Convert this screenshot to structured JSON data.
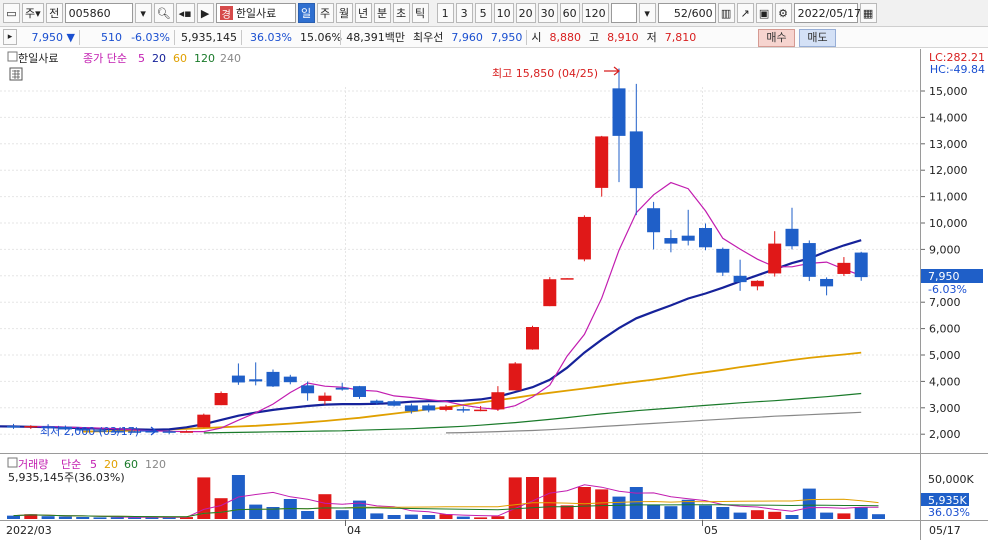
{
  "toolbar": {
    "market": "주",
    "kind": "전",
    "code": "005860",
    "name_badge": "경",
    "name": "한일사료",
    "periods": [
      "일",
      "주",
      "월",
      "년",
      "분",
      "초",
      "틱"
    ],
    "selected_period": "일",
    "intervals": [
      "1",
      "3",
      "5",
      "10",
      "20",
      "30",
      "60",
      "120"
    ],
    "count": "52",
    "count_total": "/600",
    "date": "2022/05/17"
  },
  "quote": {
    "price": "7,950 ▼",
    "change": "510",
    "change_pct": "-6.03%",
    "volume": "5,935,145",
    "vol_ratio": "36.03%",
    "turnover": "15.06%",
    "amount": "48,391백만",
    "best_ask_label": "최우선",
    "best_ask": "7,960",
    "best_bid": "7,950",
    "open_label": "시",
    "open": "8,880",
    "high_label": "고",
    "high": "8,910",
    "low_label": "저",
    "low": "7,810",
    "buy": "매수",
    "sell": "매도"
  },
  "price_panel": {
    "title": "한일사료",
    "ma_legend": "종가 단순",
    "ma_periods": [
      {
        "label": "5",
        "color": "#c21db0"
      },
      {
        "label": "20",
        "color": "#16229a"
      },
      {
        "label": "60",
        "color": "#e0a000"
      },
      {
        "label": "120",
        "color": "#1a7a2a"
      },
      {
        "label": "240",
        "color": "#888888"
      }
    ],
    "lc": "LC:282.21",
    "hc": "HC:-49.84",
    "high_note": "최고 15,850 (04/25)",
    "low_note": "최저 2,000 (03/17)",
    "last_price": "7,950",
    "last_pct": "-6.03%",
    "y_ticks": [
      "15,000",
      "14,000",
      "13,000",
      "12,000",
      "11,000",
      "10,000",
      "9,000",
      "8,000",
      "7,000",
      "6,000",
      "5,000",
      "4,000",
      "3,000",
      "2,000"
    ]
  },
  "volume_panel": {
    "title": "거래량",
    "ma_legend": "단순",
    "ma_periods": [
      {
        "label": "5",
        "color": "#c21db0"
      },
      {
        "label": "20",
        "color": "#e0a000"
      },
      {
        "label": "60",
        "color": "#1a7a2a"
      },
      {
        "label": "120",
        "color": "#888888"
      }
    ],
    "info": "5,935,145주(36.03%)",
    "y_tick": "50,000K",
    "last_volume": "5,935K",
    "last_pct": "36.03%"
  },
  "x_axis": {
    "labels": [
      "2022/03",
      "04",
      "05",
      "05/17"
    ]
  },
  "colors": {
    "up": "#e01818",
    "down": "#1f5fc8",
    "ma5": "#c21db0",
    "ma20": "#16229a",
    "ma60": "#e0a000",
    "ma120": "#1a7a2a",
    "ma240": "#888888"
  },
  "chart_data": {
    "type": "candlestick",
    "price_unit": "KRW",
    "candles": [
      {
        "o": 2310,
        "h": 2390,
        "l": 2200,
        "c": 2250
      },
      {
        "o": 2280,
        "h": 2340,
        "l": 2200,
        "c": 2310
      },
      {
        "o": 2300,
        "h": 2380,
        "l": 2200,
        "c": 2230
      },
      {
        "o": 2280,
        "h": 2330,
        "l": 2150,
        "c": 2180
      },
      {
        "o": 2200,
        "h": 2260,
        "l": 2100,
        "c": 2140
      },
      {
        "o": 2150,
        "h": 2220,
        "l": 2050,
        "c": 2100
      },
      {
        "o": 2120,
        "h": 2160,
        "l": 2060,
        "c": 2110
      },
      {
        "o": 2110,
        "h": 2130,
        "l": 2080,
        "c": 2100
      },
      {
        "o": 2120,
        "h": 2140,
        "l": 2090,
        "c": 2110
      },
      {
        "o": 2110,
        "h": 2140,
        "l": 2000,
        "c": 2090
      },
      {
        "o": 2100,
        "h": 2140,
        "l": 2080,
        "c": 2110
      },
      {
        "o": 2260,
        "h": 2780,
        "l": 2260,
        "c": 2740
      },
      {
        "o": 3100,
        "h": 3620,
        "l": 3100,
        "c": 3560
      },
      {
        "o": 4220,
        "h": 4680,
        "l": 3870,
        "c": 3960
      },
      {
        "o": 4080,
        "h": 4720,
        "l": 3850,
        "c": 4000
      },
      {
        "o": 4360,
        "h": 4450,
        "l": 3790,
        "c": 3810
      },
      {
        "o": 4180,
        "h": 4250,
        "l": 3890,
        "c": 3970
      },
      {
        "o": 3850,
        "h": 4000,
        "l": 3270,
        "c": 3550
      },
      {
        "o": 3260,
        "h": 3580,
        "l": 3120,
        "c": 3460
      },
      {
        "o": 3760,
        "h": 3950,
        "l": 3650,
        "c": 3690
      },
      {
        "o": 3820,
        "h": 3830,
        "l": 3340,
        "c": 3410
      },
      {
        "o": 3270,
        "h": 3310,
        "l": 3110,
        "c": 3180
      },
      {
        "o": 3250,
        "h": 3300,
        "l": 3050,
        "c": 3080
      },
      {
        "o": 3090,
        "h": 3160,
        "l": 2780,
        "c": 2870
      },
      {
        "o": 3090,
        "h": 3150,
        "l": 2830,
        "c": 2900
      },
      {
        "o": 2920,
        "h": 3110,
        "l": 2870,
        "c": 3050
      },
      {
        "o": 2950,
        "h": 3050,
        "l": 2820,
        "c": 2900
      },
      {
        "o": 2910,
        "h": 3070,
        "l": 2870,
        "c": 2930
      },
      {
        "o": 2940,
        "h": 3820,
        "l": 2880,
        "c": 3590
      },
      {
        "o": 3660,
        "h": 4730,
        "l": 3660,
        "c": 4680
      },
      {
        "o": 5210,
        "h": 6110,
        "l": 5200,
        "c": 6060
      },
      {
        "o": 6850,
        "h": 7950,
        "l": 6850,
        "c": 7870
      },
      {
        "o": 7900,
        "h": 7910,
        "l": 7890,
        "c": 7910
      },
      {
        "o": 8620,
        "h": 10290,
        "l": 8550,
        "c": 10230
      },
      {
        "o": 11330,
        "h": 13300,
        "l": 11000,
        "c": 13280
      },
      {
        "o": 15100,
        "h": 15850,
        "l": 11550,
        "c": 13300
      },
      {
        "o": 13470,
        "h": 15270,
        "l": 10300,
        "c": 11320
      },
      {
        "o": 10560,
        "h": 10800,
        "l": 9000,
        "c": 9650
      },
      {
        "o": 9430,
        "h": 9740,
        "l": 8890,
        "c": 9220
      },
      {
        "o": 9520,
        "h": 10500,
        "l": 9150,
        "c": 9330
      },
      {
        "o": 9810,
        "h": 9980,
        "l": 8970,
        "c": 9080
      },
      {
        "o": 9020,
        "h": 9070,
        "l": 7990,
        "c": 8120
      },
      {
        "o": 8000,
        "h": 8610,
        "l": 7430,
        "c": 7760
      },
      {
        "o": 7600,
        "h": 7830,
        "l": 7450,
        "c": 7810
      },
      {
        "o": 8090,
        "h": 9690,
        "l": 7970,
        "c": 9220
      },
      {
        "o": 9780,
        "h": 10580,
        "l": 9000,
        "c": 9120
      },
      {
        "o": 9240,
        "h": 9340,
        "l": 7800,
        "c": 7960
      },
      {
        "o": 7880,
        "h": 7940,
        "l": 7260,
        "c": 7600
      },
      {
        "o": 8070,
        "h": 8710,
        "l": 7990,
        "c": 8490
      },
      {
        "o": 8880,
        "h": 8910,
        "l": 7810,
        "c": 7950
      }
    ],
    "volume_k": [
      4200,
      6000,
      3500,
      3000,
      2500,
      2000,
      2200,
      1800,
      1900,
      2100,
      2400,
      52000,
      26000,
      55000,
      18000,
      15000,
      25000,
      10000,
      31000,
      11000,
      23000,
      7000,
      5000,
      5500,
      5000,
      6000,
      3000,
      2000,
      3500,
      52000,
      52500,
      52000,
      17000,
      40000,
      37000,
      28000,
      40000,
      18000,
      16000,
      24000,
      17000,
      15000,
      8000,
      11000,
      9000,
      5000,
      38000,
      8000,
      7000,
      15000,
      6000
    ],
    "ma5": [
      2280,
      2290,
      2270,
      2250,
      2230,
      2200,
      2160,
      2130,
      2110,
      2100,
      2100,
      2230,
      2530,
      2810,
      3140,
      3580,
      3940,
      3820,
      3780,
      3670,
      3630,
      3450,
      3390,
      3310,
      3240,
      3100,
      3000,
      2940,
      3080,
      3410,
      3860,
      4960,
      5780,
      7150,
      8970,
      10390,
      11070,
      11530,
      11300,
      10460,
      9420,
      9010,
      8630,
      8340,
      8340,
      8470,
      8520,
      8250,
      8010
    ],
    "ma20": [
      2300,
      2300,
      2290,
      2280,
      2270,
      2250,
      2230,
      2210,
      2190,
      2180,
      2170,
      2180,
      2260,
      2380,
      2540,
      2700,
      2820,
      2920,
      3000,
      3070,
      3120,
      3140,
      3140,
      3150,
      3180,
      3230,
      3250,
      3250,
      3270,
      3320,
      3420,
      3600,
      3780,
      4060,
      4520,
      5090,
      5580,
      6020,
      6390,
      6640,
      6880,
      7140,
      7330,
      7550,
      7790,
      8020,
      8250,
      8480,
      8660,
      8920,
      9150,
      9350
    ],
    "ma60": [
      2100,
      2110,
      2120,
      2140,
      2160,
      2180,
      2200,
      2230,
      2260,
      2290,
      2320,
      2360,
      2400,
      2450,
      2500,
      2560,
      2620,
      2700,
      2780,
      2860,
      2940,
      3020,
      3110,
      3200,
      3290,
      3380,
      3480,
      3570,
      3650,
      3730,
      3820,
      3910,
      3990,
      4070,
      4160,
      4260,
      4350,
      4440,
      4540,
      4630,
      4720,
      4810,
      4890,
      4960,
      5020,
      5090
    ],
    "ma120": [
      2050,
      2060,
      2070,
      2080,
      2090,
      2100,
      2110,
      2120,
      2130,
      2150,
      2170,
      2190,
      2210,
      2240,
      2270,
      2300,
      2340,
      2390,
      2440,
      2500,
      2560,
      2630,
      2700,
      2770,
      2830,
      2890,
      2940,
      2990,
      3040,
      3090,
      3140,
      3190,
      3230,
      3270,
      3320,
      3370,
      3420,
      3480,
      3540
    ],
    "ma240": [
      2050,
      2060,
      2080,
      2100,
      2120,
      2140,
      2170,
      2210,
      2250,
      2290,
      2330,
      2370,
      2410,
      2450,
      2490,
      2530,
      2570,
      2610,
      2640,
      2680,
      2710,
      2740,
      2770,
      2800,
      2830
    ]
  }
}
